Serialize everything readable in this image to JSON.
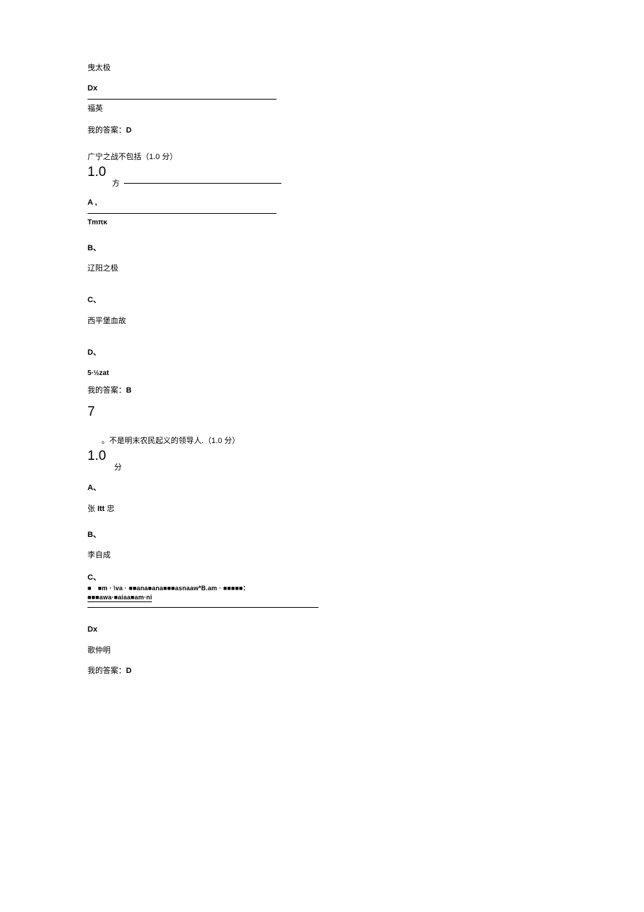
{
  "q5": {
    "option_c_text": "曳太极",
    "option_d_label": "Dx",
    "option_d_text": "福英",
    "my_answer_label": "我的答案：",
    "my_answer_value": "D"
  },
  "q6": {
    "question": "广宁之战不包括（1.0 分）",
    "score_number": "1.0",
    "score_unit": "方",
    "option_a_label": "A ,",
    "option_a_text": "Tmπκ",
    "option_b_label": "B、",
    "option_b_text": "辽阳之极",
    "option_c_label": "C、",
    "option_c_text": "西平堡血故",
    "option_d_label": "D、",
    "option_d_text": "5∙½zat",
    "my_answer_label": "我的答案：",
    "my_answer_value": "B"
  },
  "q7": {
    "number": "7",
    "question": "。不是明末农民起义的领导人.（1.0 分）",
    "score_number": "1.0",
    "score_unit": "分",
    "option_a_label": "A、",
    "option_a_text": "张 Itt 忠",
    "option_b_label": "B、",
    "option_b_text": "李自成",
    "option_c_label": "C、",
    "option_c_line1": "■　■m · \\va · ■■ana■ana■■■asnaaw*B.am · ■■■■■：",
    "option_c_line2": "■■■awa·■aiaa■am·ni",
    "option_d_label": "Dx",
    "option_d_text": "歌仲明",
    "my_answer_label": "我的答案：",
    "my_answer_value": "D"
  }
}
